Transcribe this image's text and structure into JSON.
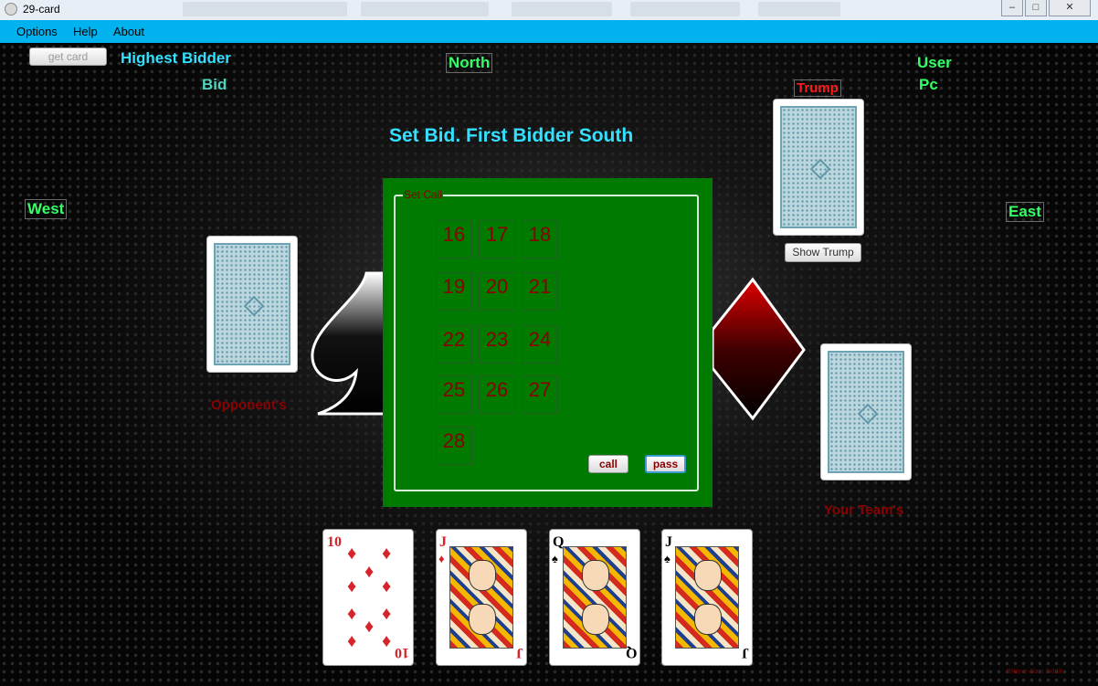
{
  "window": {
    "title": "29-card",
    "minimize": "–",
    "maximize": "□",
    "close": "✕"
  },
  "menu": [
    "Options",
    "Help",
    "About"
  ],
  "controls": {
    "get_card": "get card",
    "show_trump": "Show Trump"
  },
  "labels": {
    "highest_bidder": "Highest Bidder",
    "bid": "Bid",
    "north": "North",
    "user": "User",
    "pc": "Pc",
    "trump": "Trump",
    "west": "West",
    "east": "East",
    "status": "Set Bid. First Bidder South",
    "opponents": "Opponent's",
    "your_team": "Your Team's",
    "credit": "BNur-e-Alam Siddik"
  },
  "dialog": {
    "legend": "Set Call",
    "bids": [
      "16",
      "17",
      "18",
      "19",
      "20",
      "21",
      "22",
      "23",
      "24",
      "25",
      "26",
      "27",
      "28"
    ],
    "call_label": "call",
    "pass_label": "pass"
  },
  "hand": [
    {
      "rank": "10",
      "suit": "♦",
      "color": "#d8232a"
    },
    {
      "rank": "J",
      "suit": "♦",
      "color": "#d8232a"
    },
    {
      "rank": "Q",
      "suit": "♠",
      "color": "#000000"
    },
    {
      "rank": "J",
      "suit": "♠",
      "color": "#000000"
    }
  ],
  "colors": {
    "menu_bar": "#00b2ee",
    "cyan_text": "#33e0ff",
    "teal_text": "#4fd3c0",
    "green_text": "#33ff66",
    "red_text": "#ff1a1a",
    "dark_red_text": "#8b0000",
    "dialog_green": "#007a00"
  },
  "icons": [
    "app-icon",
    "spade-icon",
    "diamond-icon"
  ]
}
